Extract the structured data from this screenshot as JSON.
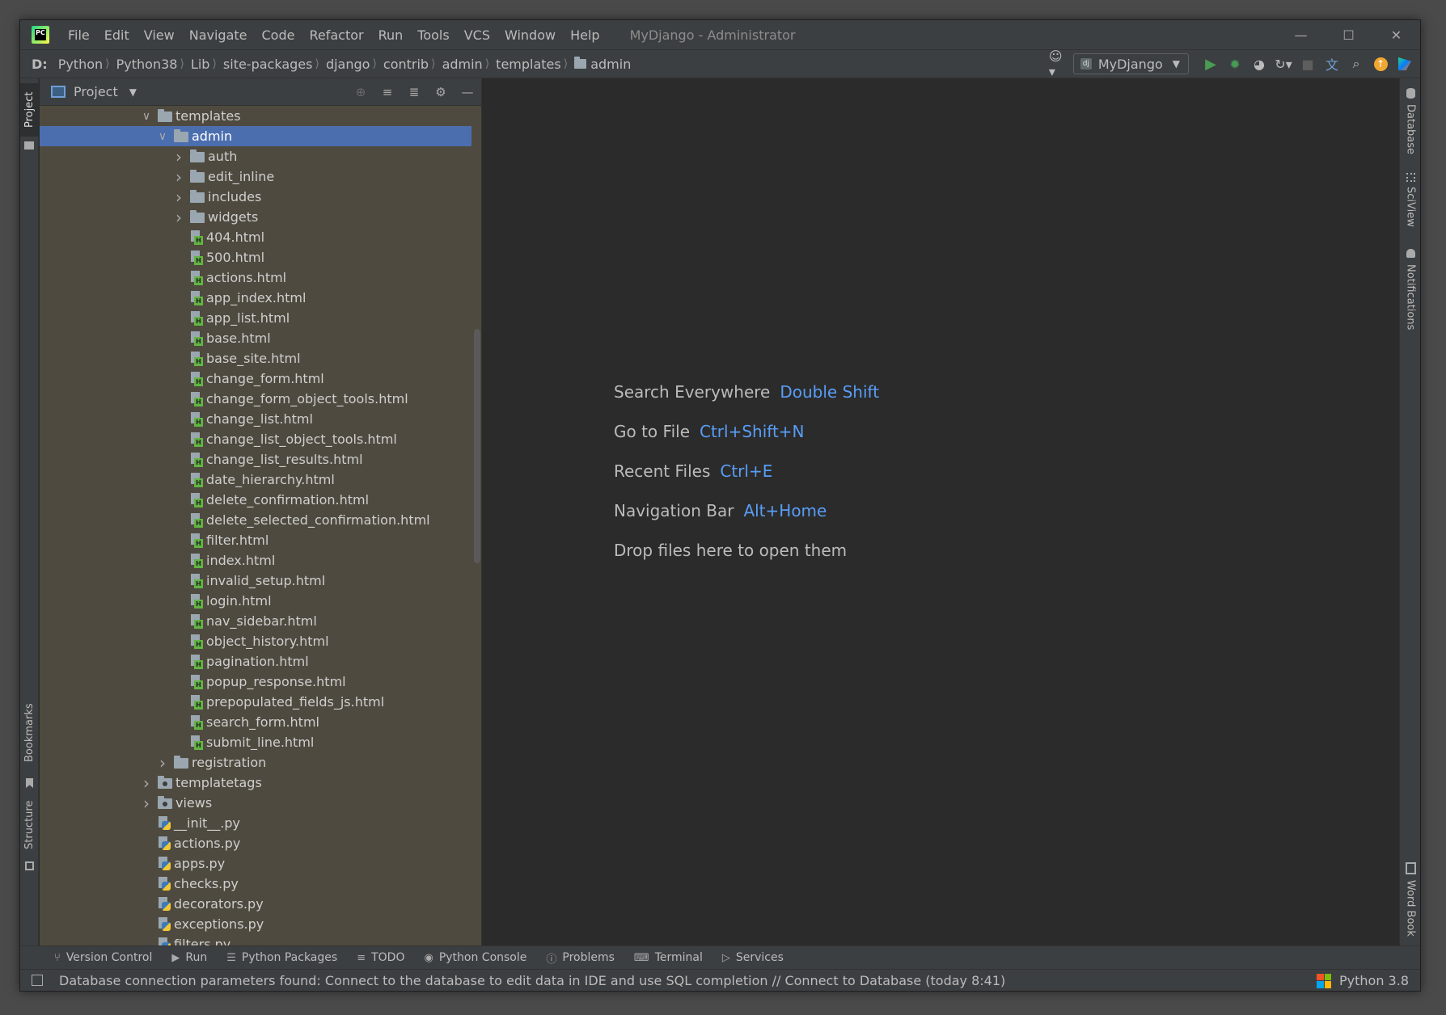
{
  "titlebar": {
    "menu": [
      "File",
      "Edit",
      "View",
      "Navigate",
      "Code",
      "Refactor",
      "Run",
      "Tools",
      "VCS",
      "Window",
      "Help"
    ],
    "title": "MyDjango - Administrator"
  },
  "navbar": {
    "crumbs": [
      "D:",
      "Python",
      "Python38",
      "Lib",
      "site-packages",
      "django",
      "contrib",
      "admin",
      "templates",
      "admin"
    ],
    "run_config": "MyDjango"
  },
  "left_tabs": {
    "project": "Project",
    "bookmarks": "Bookmarks",
    "structure": "Structure"
  },
  "right_tabs": {
    "database": "Database",
    "sciview": "SciView",
    "notifications": "Notifications",
    "wordbook": "Word Book"
  },
  "project_panel": {
    "title": "Project",
    "tree": [
      {
        "label": "templates",
        "type": "folder",
        "depth": 0,
        "expanded": true
      },
      {
        "label": "admin",
        "type": "folder",
        "depth": 1,
        "expanded": true,
        "selected": true
      },
      {
        "label": "auth",
        "type": "folder",
        "depth": 2,
        "expanded": false
      },
      {
        "label": "edit_inline",
        "type": "folder",
        "depth": 2,
        "expanded": false
      },
      {
        "label": "includes",
        "type": "folder",
        "depth": 2,
        "expanded": false
      },
      {
        "label": "widgets",
        "type": "folder",
        "depth": 2,
        "expanded": false
      },
      {
        "label": "404.html",
        "type": "html",
        "depth": 2
      },
      {
        "label": "500.html",
        "type": "html",
        "depth": 2
      },
      {
        "label": "actions.html",
        "type": "html",
        "depth": 2
      },
      {
        "label": "app_index.html",
        "type": "html",
        "depth": 2
      },
      {
        "label": "app_list.html",
        "type": "html",
        "depth": 2
      },
      {
        "label": "base.html",
        "type": "html",
        "depth": 2
      },
      {
        "label": "base_site.html",
        "type": "html",
        "depth": 2
      },
      {
        "label": "change_form.html",
        "type": "html",
        "depth": 2
      },
      {
        "label": "change_form_object_tools.html",
        "type": "html",
        "depth": 2
      },
      {
        "label": "change_list.html",
        "type": "html",
        "depth": 2
      },
      {
        "label": "change_list_object_tools.html",
        "type": "html",
        "depth": 2
      },
      {
        "label": "change_list_results.html",
        "type": "html",
        "depth": 2
      },
      {
        "label": "date_hierarchy.html",
        "type": "html",
        "depth": 2
      },
      {
        "label": "delete_confirmation.html",
        "type": "html",
        "depth": 2
      },
      {
        "label": "delete_selected_confirmation.html",
        "type": "html",
        "depth": 2
      },
      {
        "label": "filter.html",
        "type": "html",
        "depth": 2
      },
      {
        "label": "index.html",
        "type": "html",
        "depth": 2
      },
      {
        "label": "invalid_setup.html",
        "type": "html",
        "depth": 2
      },
      {
        "label": "login.html",
        "type": "html",
        "depth": 2
      },
      {
        "label": "nav_sidebar.html",
        "type": "html",
        "depth": 2
      },
      {
        "label": "object_history.html",
        "type": "html",
        "depth": 2
      },
      {
        "label": "pagination.html",
        "type": "html",
        "depth": 2
      },
      {
        "label": "popup_response.html",
        "type": "html",
        "depth": 2
      },
      {
        "label": "prepopulated_fields_js.html",
        "type": "html",
        "depth": 2
      },
      {
        "label": "search_form.html",
        "type": "html",
        "depth": 2
      },
      {
        "label": "submit_line.html",
        "type": "html",
        "depth": 2
      },
      {
        "label": "registration",
        "type": "folder",
        "depth": 1,
        "expanded": false
      },
      {
        "label": "templatetags",
        "type": "package",
        "depth": 0,
        "expanded": false
      },
      {
        "label": "views",
        "type": "package",
        "depth": 0,
        "expanded": false
      },
      {
        "label": "__init__.py",
        "type": "py",
        "depth": 0
      },
      {
        "label": "actions.py",
        "type": "py",
        "depth": 0
      },
      {
        "label": "apps.py",
        "type": "py",
        "depth": 0
      },
      {
        "label": "checks.py",
        "type": "py",
        "depth": 0
      },
      {
        "label": "decorators.py",
        "type": "py",
        "depth": 0
      },
      {
        "label": "exceptions.py",
        "type": "py",
        "depth": 0
      },
      {
        "label": "filters.py",
        "type": "py",
        "depth": 0
      }
    ]
  },
  "editor": {
    "hints": [
      {
        "label": "Search Everywhere",
        "key": "Double Shift"
      },
      {
        "label": "Go to File",
        "key": "Ctrl+Shift+N"
      },
      {
        "label": "Recent Files",
        "key": "Ctrl+E"
      },
      {
        "label": "Navigation Bar",
        "key": "Alt+Home"
      },
      {
        "label": "Drop files here to open them",
        "key": ""
      }
    ]
  },
  "tool_windows": [
    {
      "label": "Version Control",
      "icon": "branch-icon"
    },
    {
      "label": "Run",
      "icon": "play-icon"
    },
    {
      "label": "Python Packages",
      "icon": "layers-icon"
    },
    {
      "label": "TODO",
      "icon": "list-icon"
    },
    {
      "label": "Python Console",
      "icon": "python-icon"
    },
    {
      "label": "Problems",
      "icon": "warning-icon"
    },
    {
      "label": "Terminal",
      "icon": "terminal-icon"
    },
    {
      "label": "Services",
      "icon": "services-icon"
    }
  ],
  "statusbar": {
    "message": "Database connection parameters found: Connect to the database to edit data in IDE and use SQL completion // Connect to Database (today 8:41)",
    "interpreter": "Python 3.8"
  },
  "colors": {
    "selection": "#4b6eaf",
    "link_key": "#589df6",
    "panel_bg": "#4f4a3f",
    "run_green": "#499c54"
  }
}
